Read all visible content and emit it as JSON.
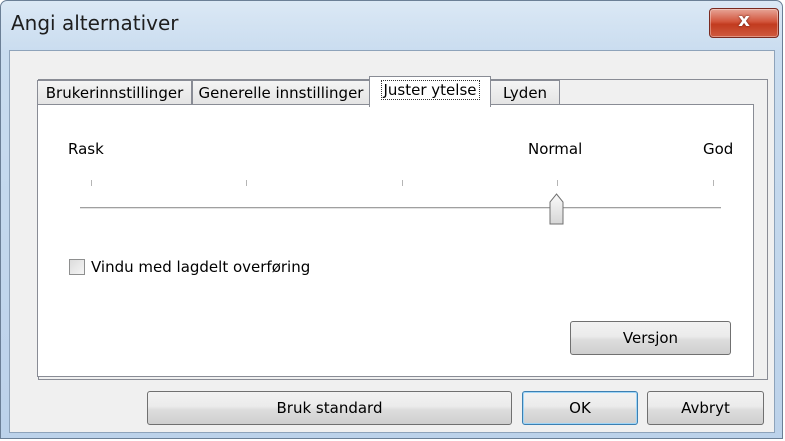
{
  "window": {
    "title": "Angi alternativer",
    "close_glyph": "x"
  },
  "tabs": [
    {
      "label": "Brukerinnstillinger",
      "active": false
    },
    {
      "label": "Generelle innstillinger",
      "active": false
    },
    {
      "label": "Juster ytelse",
      "active": true
    },
    {
      "label": "Lyden",
      "active": false
    }
  ],
  "performance": {
    "left_label": "Rask",
    "middle_label": "Normal",
    "right_label": "God",
    "slider": {
      "positions": 5,
      "selected_index": 3
    }
  },
  "layered_transfer": {
    "label": "Vindu med lagdelt overføring",
    "checked": false
  },
  "buttons": {
    "version": "Versjon",
    "use_default": "Bruk standard",
    "ok": "OK",
    "cancel": "Avbryt"
  },
  "colors": {
    "title_bar": "#bcd2ea",
    "close_button": "#c23b1f",
    "default_button_border": "#3c7fb1"
  }
}
